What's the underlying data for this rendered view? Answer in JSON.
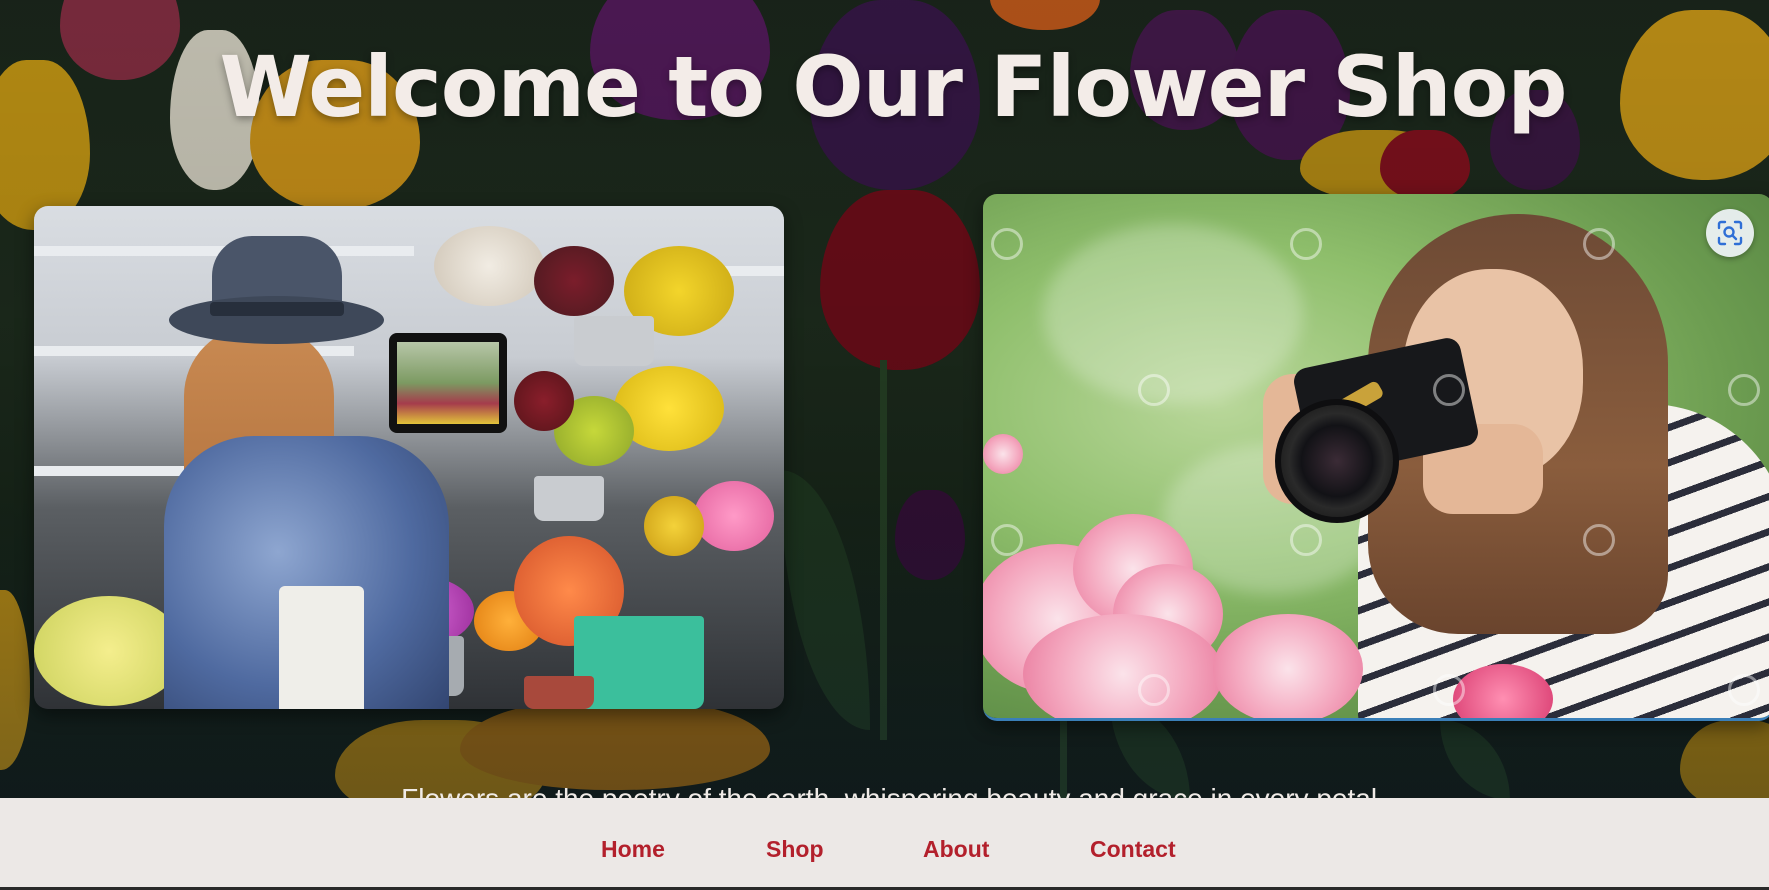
{
  "hero": {
    "title": "Welcome to Our Flower Shop",
    "tagline": "Flowers are the poetry of the earth, whispering beauty and grace in every petal."
  },
  "photos": [
    {
      "name": "florist-photo"
    },
    {
      "name": "photographer-photo"
    }
  ],
  "visual_search_button": {
    "icon": "lens-scan-icon"
  },
  "nav": {
    "items": [
      {
        "label": "Home"
      },
      {
        "label": "Shop"
      },
      {
        "label": "About"
      },
      {
        "label": "Contact"
      }
    ]
  },
  "colors": {
    "nav_link": "#b3202c",
    "nav_background": "#ece8e6",
    "title": "#f3ece8"
  }
}
